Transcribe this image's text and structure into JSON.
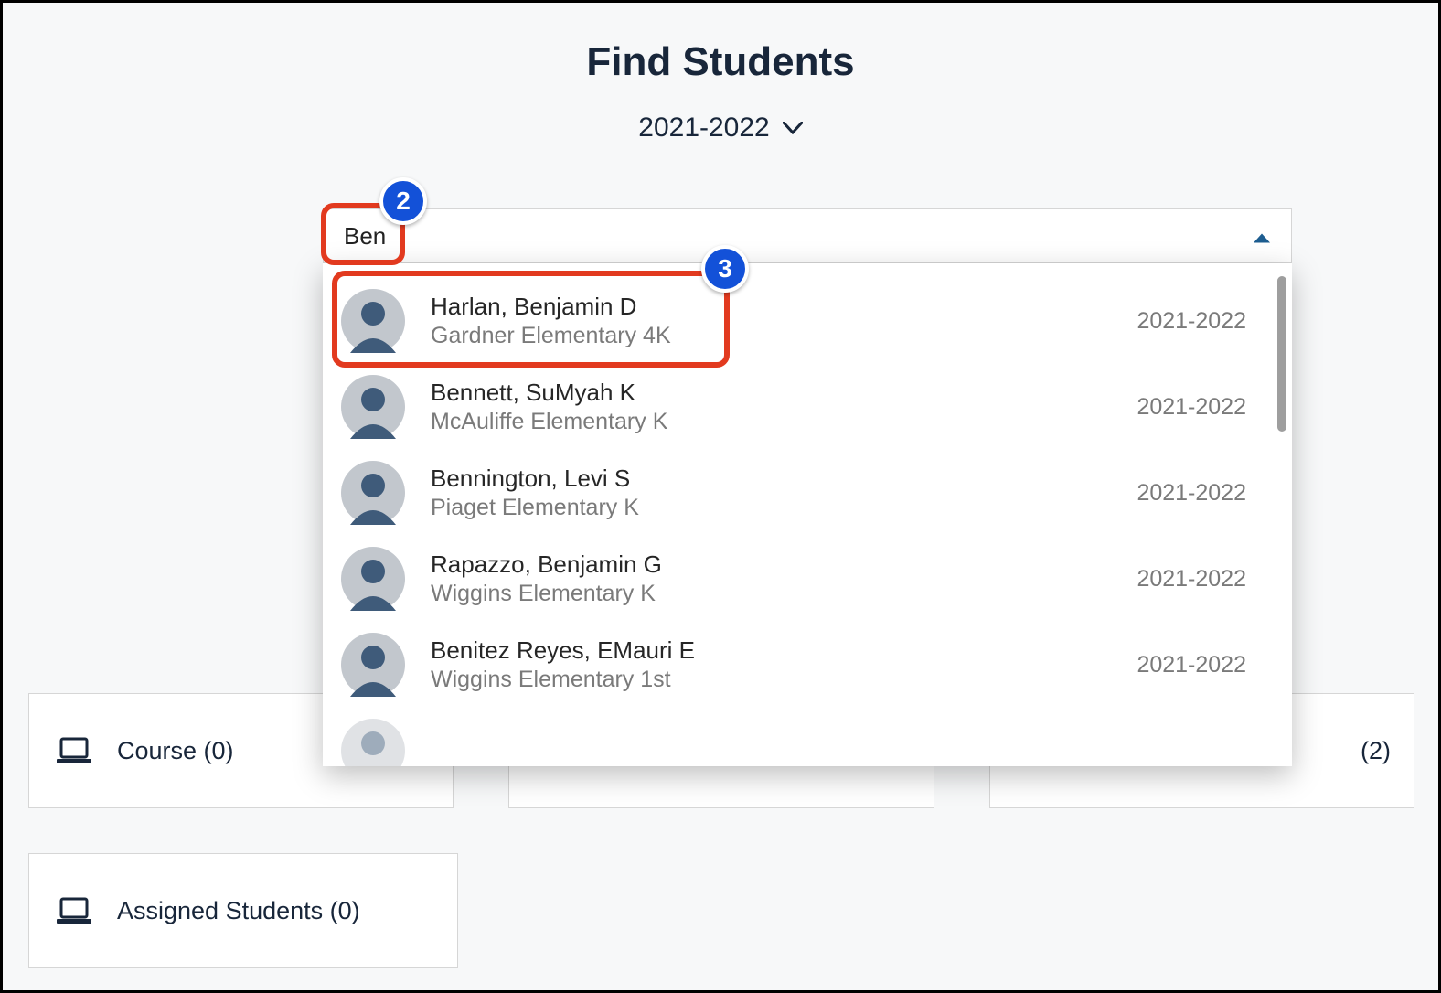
{
  "title": "Find Students",
  "year_selector": "2021-2022",
  "search_value": "Ben",
  "callouts": {
    "input": "2",
    "row": "3"
  },
  "results": [
    {
      "name": "Harlan, Benjamin D",
      "school": "Gardner Elementary 4K",
      "year": "2021-2022"
    },
    {
      "name": "Bennett, SuMyah K",
      "school": "McAuliffe Elementary K",
      "year": "2021-2022"
    },
    {
      "name": "Bennington, Levi S",
      "school": "Piaget Elementary K",
      "year": "2021-2022"
    },
    {
      "name": "Rapazzo, Benjamin G",
      "school": "Wiggins Elementary K",
      "year": "2021-2022"
    },
    {
      "name": "Benitez Reyes, EMauri E",
      "school": "Wiggins Elementary 1st",
      "year": "2021-2022"
    }
  ],
  "cards": {
    "course": "Course (0)",
    "right_tail": "(2)",
    "assigned": "Assigned Students (0)"
  }
}
